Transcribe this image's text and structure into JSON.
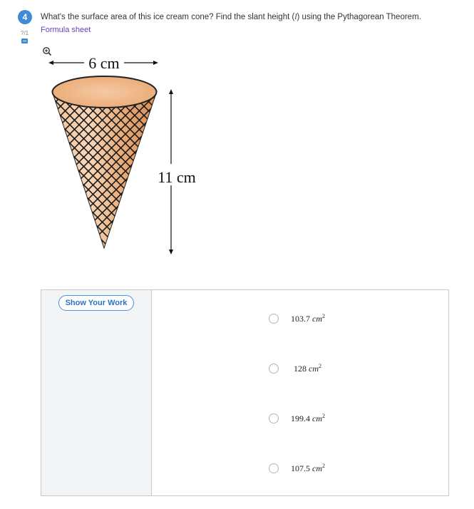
{
  "question": {
    "number": "4",
    "points": "?/1",
    "text_before": "What's the surface area of this ice cream cone? Find the slant height (",
    "variable": "l",
    "text_after": ") using the Pythagorean Theorem.",
    "formula_link": "Formula sheet"
  },
  "figure": {
    "diameter_label": "6 cm",
    "height_label": "11 cm",
    "colors": {
      "rim": "#f2b98e",
      "waffle": "#e8a96f",
      "lines": "#1a1a1a"
    }
  },
  "work": {
    "show_work_label": "Show Your Work"
  },
  "choices": [
    {
      "value": "103.7",
      "unit": "cm",
      "exp": "2"
    },
    {
      "value": "128",
      "unit": "cm",
      "exp": "2"
    },
    {
      "value": "199.4",
      "unit": "cm",
      "exp": "2"
    },
    {
      "value": "107.5",
      "unit": "cm",
      "exp": "2"
    }
  ],
  "icons": [
    "zoom-in-icon",
    "flag-icon"
  ],
  "accent": "#3d8bd9"
}
